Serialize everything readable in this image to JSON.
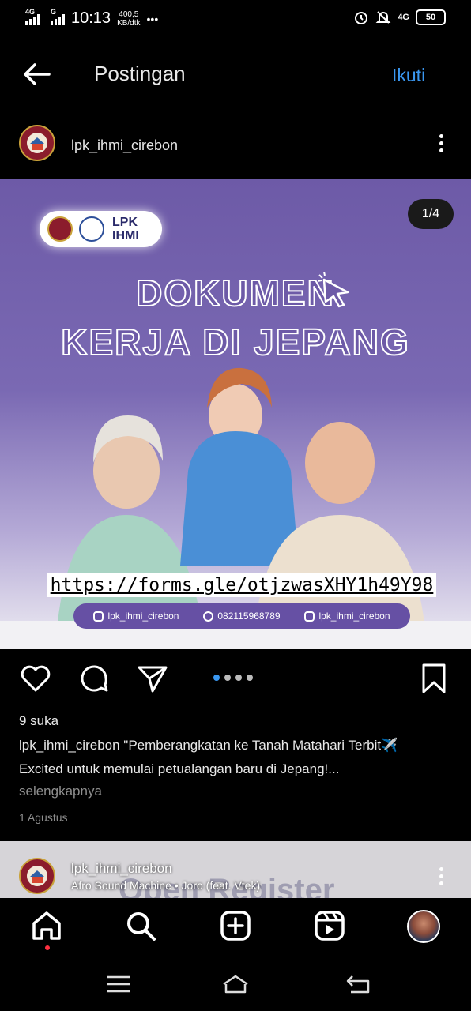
{
  "status_bar": {
    "net1": "4G",
    "net2": "G",
    "time": "10:13",
    "speed_value": "400,5",
    "speed_unit": "KB/dtk",
    "more": "•••",
    "net_right": "4G",
    "battery": "50"
  },
  "header": {
    "title": "Postingan",
    "follow_label": "Ikuti"
  },
  "post": {
    "username": "lpk_ihmi_cirebon",
    "counter": "1/4",
    "image": {
      "logo_text_line1": "LPK",
      "logo_text_line2": "IHMI",
      "headline1": "DOKUMEN",
      "headline2": "KERJA DI JEPANG",
      "url": "https://forms.gle/otjzwasXHY1h49Y98",
      "contact_instagram": "lpk_ihmi_cirebon",
      "contact_phone": "082115968789",
      "contact_tiktok": "lpk_ihmi_cirebon"
    },
    "likes": "9 suka",
    "caption_user": "lpk_ihmi_cirebon",
    "caption_line1": " \"Pemberangkatan ke Tanah Matahari Terbit✈️",
    "caption_line2": "Excited untuk memulai petualangan baru di Jepang!...",
    "more_label": "selengkapnya",
    "date": "1 Agustus",
    "carousel_total": 4,
    "carousel_current": 1
  },
  "next_post": {
    "username": "lpk_ihmi_cirebon",
    "song": "Afro Sound Machine • Joro (feat. Vtek)",
    "ghost_text": "Open Register"
  },
  "icons": {
    "back": "arrow-left-icon",
    "menu": "more-vertical-icon",
    "like": "heart-icon",
    "comment": "comment-icon",
    "share": "send-icon",
    "save": "bookmark-icon",
    "home": "home-icon",
    "search": "search-icon",
    "create": "plus-square-icon",
    "reels": "reels-icon"
  },
  "colors": {
    "accent": "#3a97f0",
    "image_purple": "#6d5aa7",
    "notif": "#ff3040"
  }
}
